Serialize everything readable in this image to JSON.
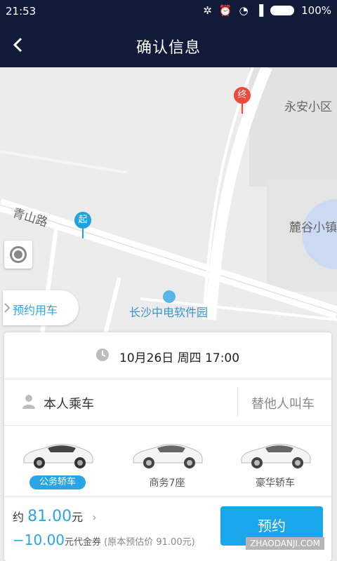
{
  "status_bar": {
    "time": "21:53",
    "battery": "100%"
  },
  "header": {
    "title": "确认信息"
  },
  "map": {
    "labels": {
      "road_qingshan": "青山路",
      "area_yongan": "永安小区",
      "area_lugu": "麓谷小镇",
      "poi_software_park": "长沙中电软件园"
    },
    "start_pin": "起",
    "end_pin": "终"
  },
  "reserve_button": {
    "label": "预约用车"
  },
  "trip": {
    "datetime": "10月26日 周四 17:00",
    "rider_self": "本人乘车",
    "rider_other": "替他人叫车"
  },
  "cars": [
    {
      "label": "公务轿车",
      "selected": true
    },
    {
      "label": "商务7座",
      "selected": false
    },
    {
      "label": "豪华轿车",
      "selected": false
    }
  ],
  "price": {
    "prefix": "约",
    "amount": "81.00",
    "unit": "元",
    "coupon_amount": "−10.00",
    "coupon_label": "元代金券",
    "original_note": "(原本预估价 91.00元)"
  },
  "book_button": {
    "label": "预约"
  },
  "watermark": "ZHAODANJI.COM",
  "colors": {
    "accent": "#2aa4e6",
    "header_bg": "#121a3a",
    "start_pin": "#1ea3e1",
    "end_pin": "#f0493b"
  }
}
